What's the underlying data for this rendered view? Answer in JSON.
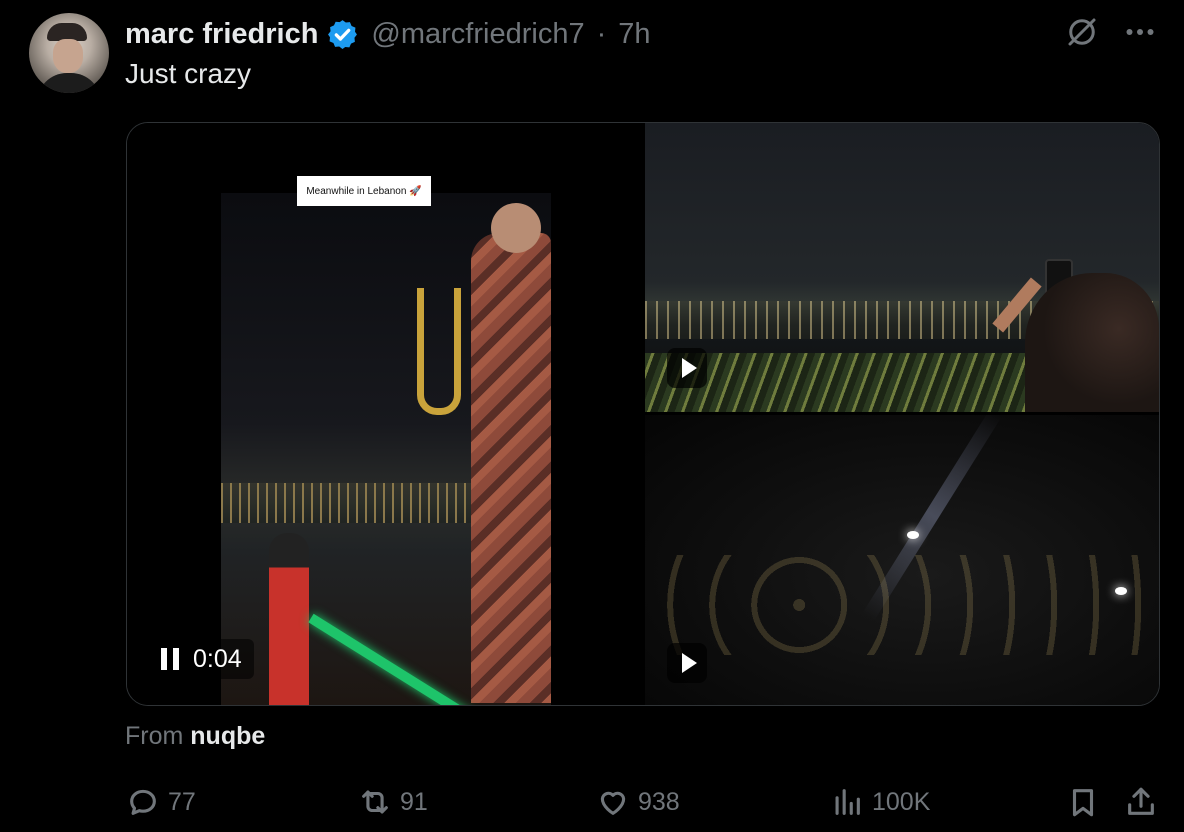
{
  "post": {
    "author_name": "marc friedrich",
    "handle": "@marcfriedrich7",
    "separator": "·",
    "time": "7h",
    "text": "Just crazy"
  },
  "media": {
    "caption_overlay": "Meanwhile in Lebanon 🚀",
    "playing_time": "0:04",
    "videos": [
      {
        "state": "playing"
      },
      {
        "state": "paused"
      },
      {
        "state": "paused"
      }
    ]
  },
  "source": {
    "prefix": "From",
    "name": "nuqbe"
  },
  "actions": {
    "replies": "77",
    "reposts": "91",
    "likes": "938",
    "views": "100K"
  },
  "icons": {
    "verified": "verified-badge-icon",
    "grok": "grok-icon",
    "more": "more-icon",
    "reply": "reply-icon",
    "repost": "repost-icon",
    "like": "heart-icon",
    "views": "views-icon",
    "bookmark": "bookmark-icon",
    "share": "share-icon"
  },
  "colors": {
    "background": "#000000",
    "text": "#e7e9ea",
    "muted": "#71767b",
    "verified": "#1d9bf0"
  }
}
